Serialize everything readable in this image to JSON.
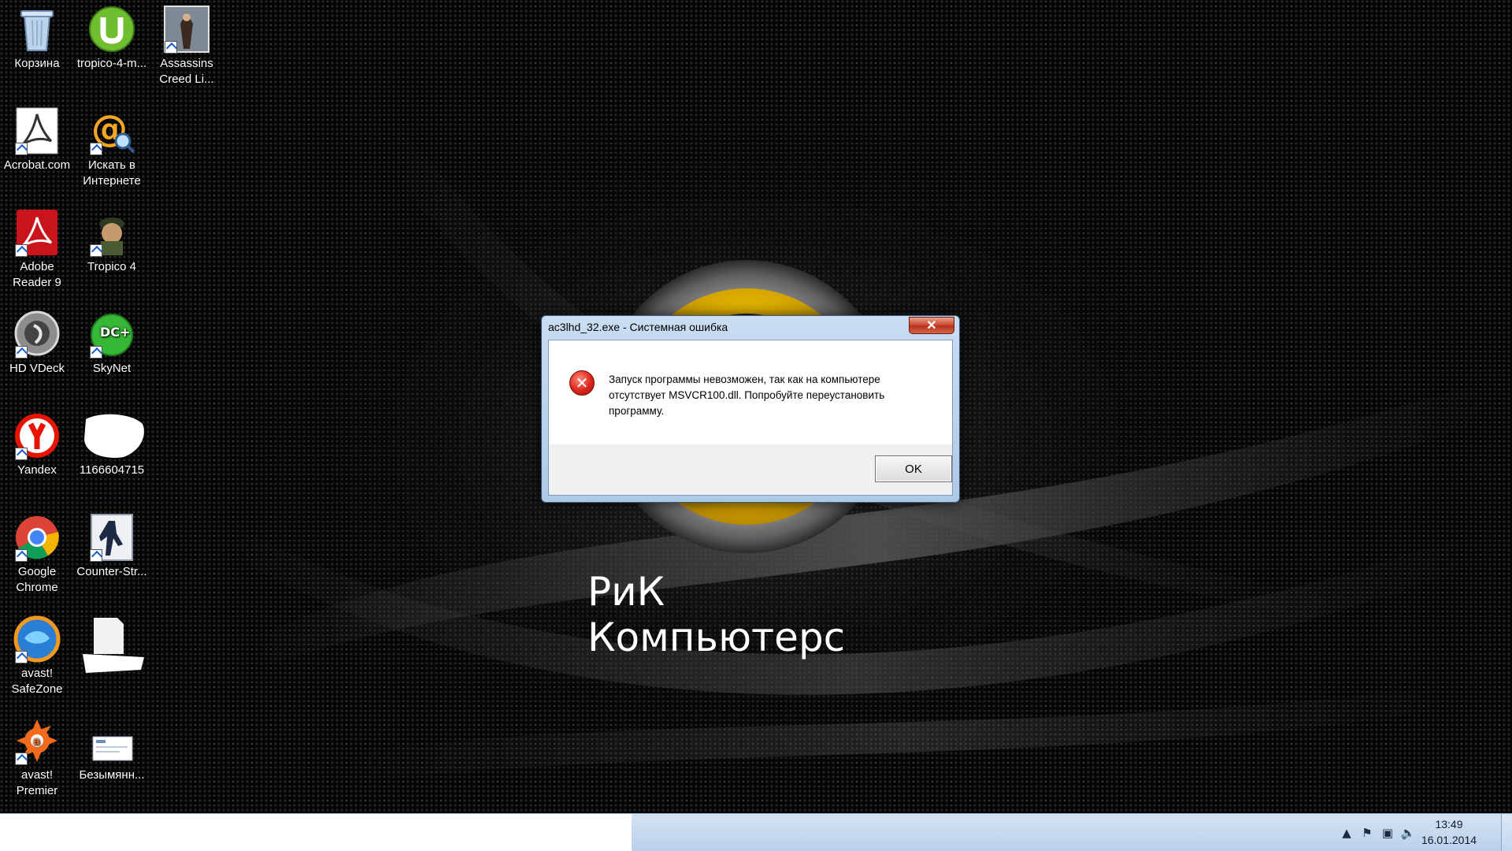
{
  "desktop": {
    "brand_text": "РиК Компьютерс",
    "icons": [
      {
        "label": "Корзина",
        "icon": "recycle-bin-icon"
      },
      {
        "label": "tropico-4-m...",
        "icon": "utorrent-icon"
      },
      {
        "label": "Assassins Creed Li...",
        "icon": "assassins-creed-icon"
      },
      {
        "label": "Acrobat.com",
        "icon": "acrobat-com-icon"
      },
      {
        "label": "Искать в Интернете",
        "icon": "search-internet-icon"
      },
      {
        "label": "Adobe Reader 9",
        "icon": "adobe-reader-icon"
      },
      {
        "label": "Tropico 4",
        "icon": "tropico-icon"
      },
      {
        "label": "HD VDeck",
        "icon": "hd-vdeck-icon"
      },
      {
        "label": "SkyNet",
        "icon": "skynet-icon"
      },
      {
        "label": "Yandex",
        "icon": "yandex-icon"
      },
      {
        "label": "1166604715",
        "icon": "redacted-icon"
      },
      {
        "label": "Google Chrome",
        "icon": "chrome-icon"
      },
      {
        "label": "Counter-Str...",
        "icon": "counter-strike-icon"
      },
      {
        "label": "avast! SafeZone",
        "icon": "avast-safezone-icon"
      },
      {
        "label": "",
        "icon": "redacted-file-icon"
      },
      {
        "label": "avast! Premier",
        "icon": "avast-premier-icon"
      },
      {
        "label": "Безымянн...",
        "icon": "untitled-image-icon"
      }
    ]
  },
  "dialog": {
    "title": "ac3lhd_32.exe - Системная ошибка",
    "close_label": "✕",
    "message": "Запуск программы невозможен, так как на компьютере отсутствует MSVCR100.dll. Попробуйте переустановить программу.",
    "ok_label": "OK",
    "error_icon": "error-icon"
  },
  "taskbar": {
    "time": "13:49",
    "date": "16.01.2014",
    "tray_icons": [
      "show-hidden-icons-icon",
      "action-center-flag-icon",
      "network-icon",
      "volume-icon"
    ]
  },
  "colors": {
    "accent_yellow": "#f2c100",
    "close_red": "#c9452c",
    "taskbar_blue": "#c6d9ee"
  }
}
